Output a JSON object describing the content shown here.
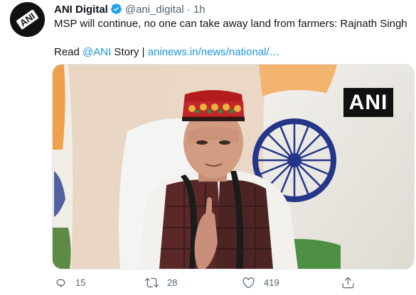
{
  "tweet": {
    "author_name": "ANI Digital",
    "handle": "@ani_digital",
    "separator": "·",
    "time": "1h",
    "text_line1": "MSP will continue, no one can take away land from farmers: Rajnath Singh",
    "read_prefix": "Read ",
    "mention": "@ANI",
    "story_word": " Story | ",
    "link_text": "aninews.in/news/national/…",
    "media_logo_text": "ANI",
    "verified_color": "#1da1f2",
    "link_color": "#1b95e0"
  },
  "actions": {
    "reply_count": "15",
    "retweet_count": "28",
    "like_count": "419",
    "reply_icon": "reply-icon",
    "retweet_icon": "retweet-icon",
    "like_icon": "heart-icon",
    "share_icon": "share-icon"
  }
}
